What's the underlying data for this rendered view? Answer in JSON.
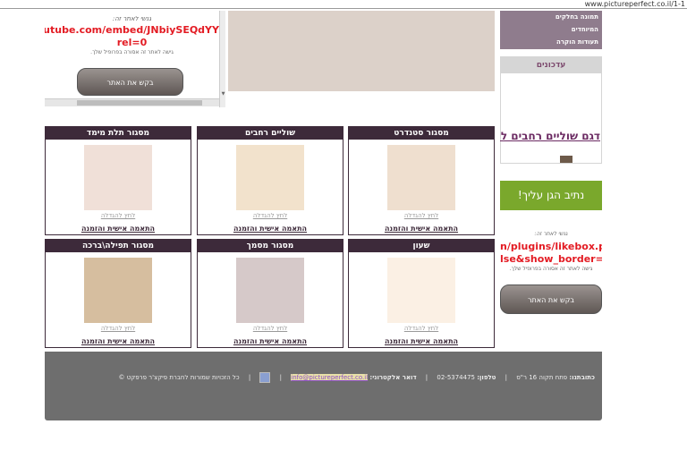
{
  "browser": {
    "url": "www.pictureperfect.co.il/1-1"
  },
  "embed_top": {
    "notice_small": "גנשי לאתר זה:",
    "url_line1": "w.youtube.com/embed/JNbiySEQdYY?",
    "url_line2": "rel=0",
    "notice_detail": "גישה לאתר זה אסורה בפרופיל שלך.",
    "request_button": "בקש את האתר"
  },
  "sidebar": {
    "nav_items": [
      "תמונה בחלקים",
      "המיוחדים",
      "תעודות הוקרה"
    ],
    "updates_title": "עדכונים",
    "updates_link": "דגם שוליים רחבים לחדשת העץ",
    "garden_button": "נתיב הגן עליך!",
    "embed_notice_small": "גנשי לאתר זה:",
    "embed_url_line1": "n/plugins/likebox.php?",
    "embed_url_line2": "lse&show_border=true",
    "embed_notice_detail": "גישה לאתר זה אסורה בפרופיל שלך.",
    "embed_request_button": "בקש את האתר"
  },
  "products": [
    {
      "title": "מסגור סטנדרט",
      "image_color": "#efdfcf",
      "enlarge": "לחץ להגדלה",
      "cta": "התאמה אישית והזמנה"
    },
    {
      "title": "שוליים רחבים",
      "image_color": "#f2e2cc",
      "enlarge": "לחץ להגדלה",
      "cta": "התאמה אישית והזמנה"
    },
    {
      "title": "מסגור תלת מימד",
      "image_color": "#f0e0d8",
      "enlarge": "לחץ להגדלה",
      "cta": "התאמה אישית והזמנה"
    },
    {
      "title": "שעון",
      "image_color": "#fbf0e4",
      "enlarge": "לחץ להגדלה",
      "cta": "התאמה אישית והזמנה"
    },
    {
      "title": "מסגור מסמך",
      "image_color": "#d6c9c9",
      "enlarge": "לחץ להגדלה",
      "cta": "התאמה אישית והזמנה"
    },
    {
      "title": "מסגור תפילה\\ברכה",
      "image_color": "#d6be9f",
      "enlarge": "לחץ להגדלה",
      "cta": "התאמה אישית והזמנה"
    }
  ],
  "footer": {
    "address_label": "כתובתנו:",
    "address": "פתח תקוה 16 ר\"ס",
    "phone_label": "טלפון:",
    "phone": "02-5374475",
    "email_label": "דואר אלקטרוני:",
    "email": "info@pictureperfect.co.il",
    "copyright": "כל הזכויות שמורות לחברת פיקצ'ר פרפקט ©"
  }
}
